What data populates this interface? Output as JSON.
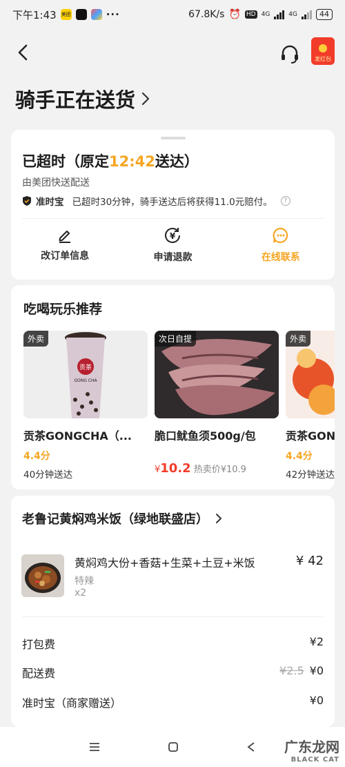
{
  "status_bar": {
    "time": "下午1:43",
    "network_speed": "67.8K/s",
    "hd": "HD",
    "net1": "4G",
    "net2": "4G",
    "battery": "44",
    "app_badge_1": "美团"
  },
  "header": {
    "page_title": "骑手正在送货",
    "redpack_label": "发红包"
  },
  "delivery_status": {
    "prefix": "已超时（原定",
    "scheduled_time": "12:42",
    "suffix": "送达）",
    "carrier": "由美团快送配送",
    "ontime_brand": "准时宝",
    "ontime_note": "已超时30分钟，骑手送达后将获得11.0元赔付。",
    "help_glyph": "?"
  },
  "actions": [
    {
      "label": "改订单信息",
      "icon": "pencil-icon"
    },
    {
      "label": "申请退款",
      "icon": "refund-icon"
    },
    {
      "label": "在线联系",
      "icon": "chat-icon"
    }
  ],
  "recommendations": {
    "title": "吃喝玩乐推荐",
    "items": [
      {
        "tag": "外卖",
        "name": "贡茶GONGCHA（...",
        "rating": "4.4分",
        "eta": "40分钟送达",
        "cup_text": "贡茶",
        "cup_brand": "GONG CHA"
      },
      {
        "tag": "次日自提",
        "name": "脆口鱿鱼须500g/包",
        "price_symbol": "¥",
        "price": "10.2",
        "hot_price": "热卖价¥10.9"
      },
      {
        "tag": "外卖",
        "name": "贡茶GONGCHA（...",
        "rating": "4.4分",
        "eta": "42分钟送达"
      }
    ]
  },
  "order": {
    "shop_name": "老鲁记黄焖鸡米饭（绿地联盛店）",
    "dish": {
      "name": "黄焖鸡大份+香菇+生菜+土豆+米饭",
      "price": "¥ 42",
      "spec": "特辣",
      "qty": "x2"
    },
    "fees": [
      {
        "label": "打包费",
        "amount": "¥2",
        "original": ""
      },
      {
        "label": "配送费",
        "amount": "¥0",
        "original": "¥2.5"
      },
      {
        "label": "准时宝（商家赠送）",
        "amount": "¥0",
        "original": ""
      }
    ]
  },
  "watermark": {
    "cn": "广东龙网",
    "en": "BLACK CAT"
  },
  "colors": {
    "accent": "#f5a623",
    "price_red": "#f23c2a",
    "background": "#f2f2f2"
  }
}
